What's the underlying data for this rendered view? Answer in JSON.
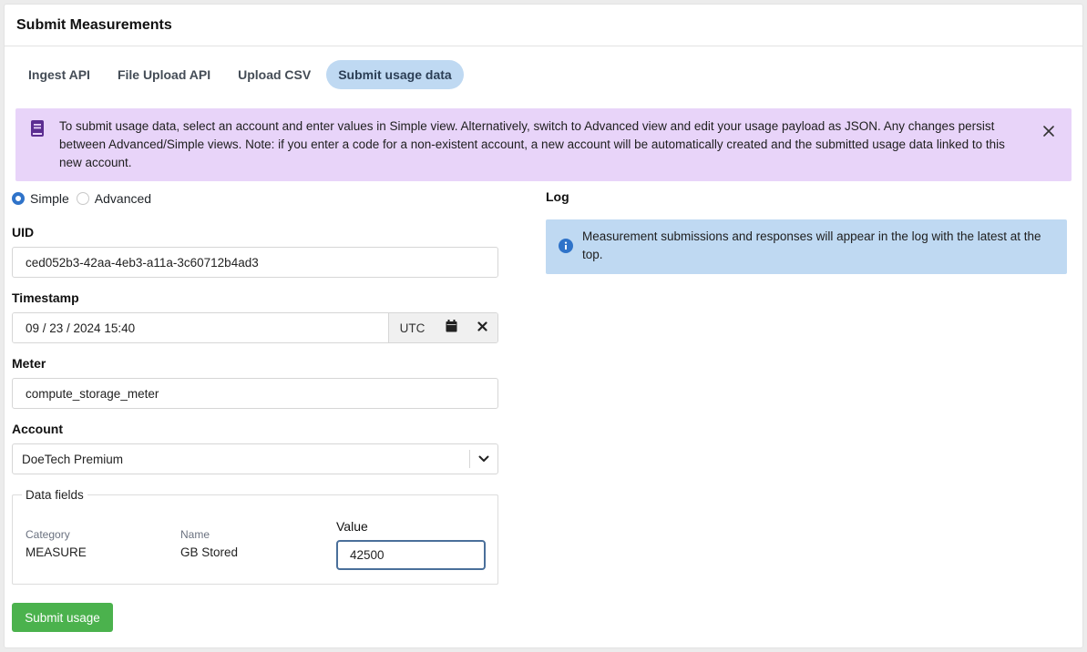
{
  "header": {
    "title": "Submit Measurements"
  },
  "tabs": [
    {
      "label": "Ingest API",
      "active": false
    },
    {
      "label": "File Upload API",
      "active": false
    },
    {
      "label": "Upload CSV",
      "active": false
    },
    {
      "label": "Submit usage data",
      "active": true
    }
  ],
  "alert": {
    "icon": "book-icon",
    "text": "To submit usage data, select an account and enter values in Simple view. Alternatively, switch to Advanced view and edit your usage payload as JSON. Any changes persist between Advanced/Simple views. Note: if you enter a code for a non-existent account, a new account will be automatically created and the submitted usage data linked to this new account."
  },
  "view_mode": {
    "options": [
      {
        "label": "Simple",
        "checked": true
      },
      {
        "label": "Advanced",
        "checked": false
      }
    ]
  },
  "form": {
    "uid": {
      "label": "UID",
      "value": "ced052b3-42aa-4eb3-a11a-3c60712b4ad3"
    },
    "timestamp": {
      "label": "Timestamp",
      "value": "09 / 23 / 2024 15:40",
      "timezone": "UTC"
    },
    "meter": {
      "label": "Meter",
      "value": "compute_storage_meter"
    },
    "account": {
      "label": "Account",
      "value": "DoeTech Premium"
    },
    "data_fields": {
      "legend": "Data fields",
      "category_label": "Category",
      "category_value": "MEASURE",
      "name_label": "Name",
      "name_value": "GB Stored",
      "value_label": "Value",
      "value": "42500"
    },
    "submit_label": "Submit usage"
  },
  "log": {
    "title": "Log",
    "info_text": "Measurement submissions and responses will appear in the log with the latest at the top."
  },
  "colors": {
    "accent": "#2f73c9",
    "tab_active_bg": "#bfd9f2",
    "alert_bg": "#e8d4f9",
    "info_bg": "#bfd9f2",
    "submit_bg": "#4bb24d"
  }
}
